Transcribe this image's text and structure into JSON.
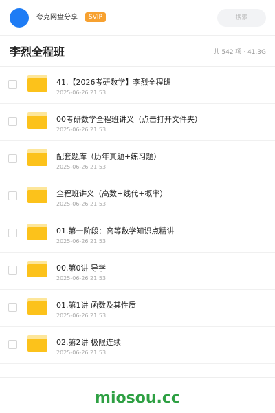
{
  "header": {
    "sharer_name": "夸克网盘分享",
    "badge": "SVIP",
    "search_placeholder": "搜索"
  },
  "folder": {
    "title": "李烈全程班",
    "stats": "共 542 项 · 41.3G"
  },
  "items": [
    {
      "name": "41.【2026考研数学】李烈全程班",
      "date": "2025-06-26 21:53"
    },
    {
      "name": "00考研数学全程班讲义（点击打开文件夹）",
      "date": "2025-06-26 21:53"
    },
    {
      "name": "配套题库（历年真题+练习题）",
      "date": "2025-06-26 21:53"
    },
    {
      "name": "全程班讲义（高数+线代+概率）",
      "date": "2025-06-26 21:53"
    },
    {
      "name": "01.第一阶段：高等数学知识点精讲",
      "date": "2025-06-26 21:53"
    },
    {
      "name": "00.第0讲 导学",
      "date": "2025-06-26 21:53"
    },
    {
      "name": "01.第1讲 函数及其性质",
      "date": "2025-06-26 21:53"
    },
    {
      "name": "02.第2讲 极限连续",
      "date": "2025-06-26 21:53"
    }
  ],
  "watermark": "miosou.cc",
  "colors": {
    "avatar": "#1e7cf5",
    "badge": "#f7a130",
    "folder": "#fcc21b",
    "watermark": "#2ea043"
  },
  "icons": {
    "avatar": "avatar",
    "folder": "folder-icon",
    "checkbox": "checkbox-icon"
  }
}
